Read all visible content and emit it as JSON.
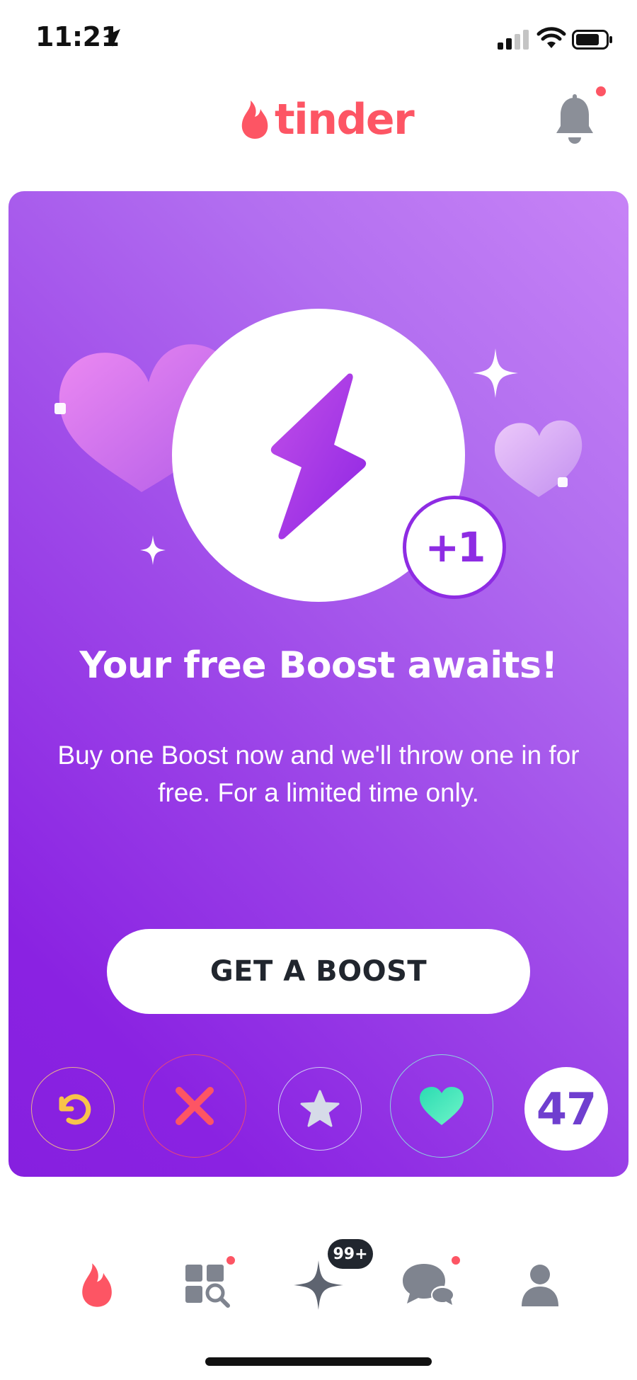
{
  "status_bar": {
    "time": "11:21"
  },
  "header": {
    "app_name": "tinder",
    "brand_color": "#fd5564"
  },
  "promo_card": {
    "badge": "+1",
    "title": "Your free Boost awaits!",
    "description": "Buy one Boost now and we'll throw one in for free. For a limited time only.",
    "button_label": "GET A BOOST",
    "accent_color": "#8e2ce3"
  },
  "actions": {
    "items": [
      {
        "name": "rewind",
        "icon": "rewind-icon"
      },
      {
        "name": "nope",
        "icon": "x-icon"
      },
      {
        "name": "super-like",
        "icon": "star-icon"
      },
      {
        "name": "like",
        "icon": "heart-icon"
      }
    ],
    "count": "47"
  },
  "bottom_nav": {
    "items": [
      {
        "name": "home",
        "icon": "flame-icon",
        "active": true
      },
      {
        "name": "explore",
        "icon": "explore-icon",
        "notification_dot": true
      },
      {
        "name": "likes",
        "icon": "sparkle-icon",
        "badge": "99+"
      },
      {
        "name": "messages",
        "icon": "chat-icon",
        "notification_dot": true
      },
      {
        "name": "profile",
        "icon": "profile-icon"
      }
    ]
  }
}
